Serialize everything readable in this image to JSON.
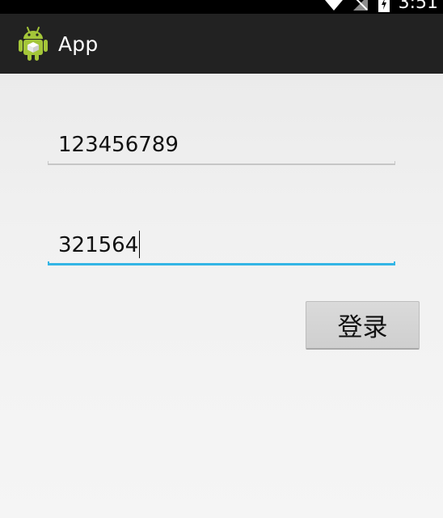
{
  "status_bar": {
    "time": "3:51",
    "icons": [
      "wifi-icon",
      "signal-icon",
      "battery-icon"
    ],
    "background": "#000000"
  },
  "action_bar": {
    "title": "App",
    "icon": "android-icon",
    "background": "#222222"
  },
  "form": {
    "username": {
      "value": "123456789",
      "focused": false
    },
    "password": {
      "value": "321564",
      "focused": true
    },
    "login_label": "登录"
  },
  "colors": {
    "accent": "#33b5e5",
    "android_green": "#a4c639",
    "inactive_line": "#c6c6c6"
  }
}
